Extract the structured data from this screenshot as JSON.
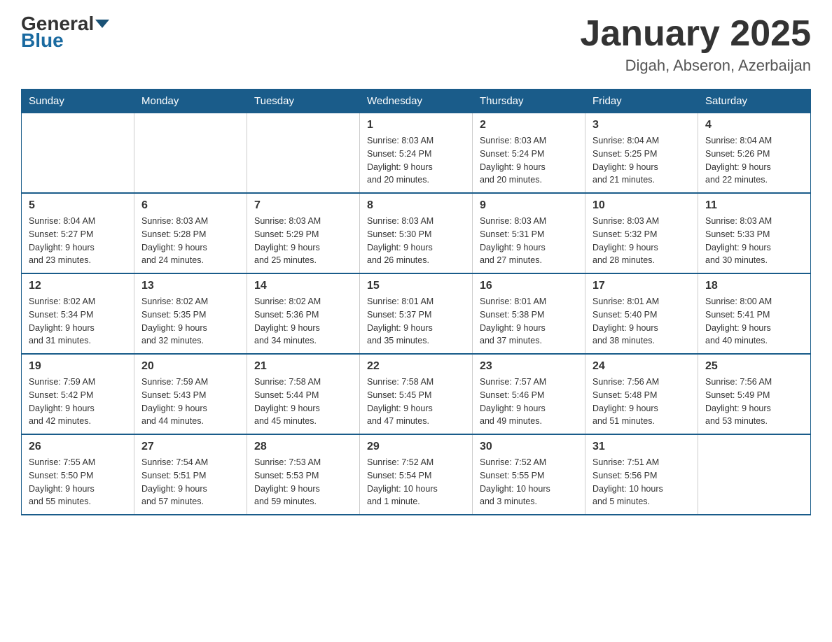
{
  "logo": {
    "general": "General",
    "blue": "Blue"
  },
  "header": {
    "month": "January 2025",
    "location": "Digah, Abseron, Azerbaijan"
  },
  "weekdays": [
    "Sunday",
    "Monday",
    "Tuesday",
    "Wednesday",
    "Thursday",
    "Friday",
    "Saturday"
  ],
  "weeks": [
    [
      {
        "day": "",
        "info": ""
      },
      {
        "day": "",
        "info": ""
      },
      {
        "day": "",
        "info": ""
      },
      {
        "day": "1",
        "info": "Sunrise: 8:03 AM\nSunset: 5:24 PM\nDaylight: 9 hours\nand 20 minutes."
      },
      {
        "day": "2",
        "info": "Sunrise: 8:03 AM\nSunset: 5:24 PM\nDaylight: 9 hours\nand 20 minutes."
      },
      {
        "day": "3",
        "info": "Sunrise: 8:04 AM\nSunset: 5:25 PM\nDaylight: 9 hours\nand 21 minutes."
      },
      {
        "day": "4",
        "info": "Sunrise: 8:04 AM\nSunset: 5:26 PM\nDaylight: 9 hours\nand 22 minutes."
      }
    ],
    [
      {
        "day": "5",
        "info": "Sunrise: 8:04 AM\nSunset: 5:27 PM\nDaylight: 9 hours\nand 23 minutes."
      },
      {
        "day": "6",
        "info": "Sunrise: 8:03 AM\nSunset: 5:28 PM\nDaylight: 9 hours\nand 24 minutes."
      },
      {
        "day": "7",
        "info": "Sunrise: 8:03 AM\nSunset: 5:29 PM\nDaylight: 9 hours\nand 25 minutes."
      },
      {
        "day": "8",
        "info": "Sunrise: 8:03 AM\nSunset: 5:30 PM\nDaylight: 9 hours\nand 26 minutes."
      },
      {
        "day": "9",
        "info": "Sunrise: 8:03 AM\nSunset: 5:31 PM\nDaylight: 9 hours\nand 27 minutes."
      },
      {
        "day": "10",
        "info": "Sunrise: 8:03 AM\nSunset: 5:32 PM\nDaylight: 9 hours\nand 28 minutes."
      },
      {
        "day": "11",
        "info": "Sunrise: 8:03 AM\nSunset: 5:33 PM\nDaylight: 9 hours\nand 30 minutes."
      }
    ],
    [
      {
        "day": "12",
        "info": "Sunrise: 8:02 AM\nSunset: 5:34 PM\nDaylight: 9 hours\nand 31 minutes."
      },
      {
        "day": "13",
        "info": "Sunrise: 8:02 AM\nSunset: 5:35 PM\nDaylight: 9 hours\nand 32 minutes."
      },
      {
        "day": "14",
        "info": "Sunrise: 8:02 AM\nSunset: 5:36 PM\nDaylight: 9 hours\nand 34 minutes."
      },
      {
        "day": "15",
        "info": "Sunrise: 8:01 AM\nSunset: 5:37 PM\nDaylight: 9 hours\nand 35 minutes."
      },
      {
        "day": "16",
        "info": "Sunrise: 8:01 AM\nSunset: 5:38 PM\nDaylight: 9 hours\nand 37 minutes."
      },
      {
        "day": "17",
        "info": "Sunrise: 8:01 AM\nSunset: 5:40 PM\nDaylight: 9 hours\nand 38 minutes."
      },
      {
        "day": "18",
        "info": "Sunrise: 8:00 AM\nSunset: 5:41 PM\nDaylight: 9 hours\nand 40 minutes."
      }
    ],
    [
      {
        "day": "19",
        "info": "Sunrise: 7:59 AM\nSunset: 5:42 PM\nDaylight: 9 hours\nand 42 minutes."
      },
      {
        "day": "20",
        "info": "Sunrise: 7:59 AM\nSunset: 5:43 PM\nDaylight: 9 hours\nand 44 minutes."
      },
      {
        "day": "21",
        "info": "Sunrise: 7:58 AM\nSunset: 5:44 PM\nDaylight: 9 hours\nand 45 minutes."
      },
      {
        "day": "22",
        "info": "Sunrise: 7:58 AM\nSunset: 5:45 PM\nDaylight: 9 hours\nand 47 minutes."
      },
      {
        "day": "23",
        "info": "Sunrise: 7:57 AM\nSunset: 5:46 PM\nDaylight: 9 hours\nand 49 minutes."
      },
      {
        "day": "24",
        "info": "Sunrise: 7:56 AM\nSunset: 5:48 PM\nDaylight: 9 hours\nand 51 minutes."
      },
      {
        "day": "25",
        "info": "Sunrise: 7:56 AM\nSunset: 5:49 PM\nDaylight: 9 hours\nand 53 minutes."
      }
    ],
    [
      {
        "day": "26",
        "info": "Sunrise: 7:55 AM\nSunset: 5:50 PM\nDaylight: 9 hours\nand 55 minutes."
      },
      {
        "day": "27",
        "info": "Sunrise: 7:54 AM\nSunset: 5:51 PM\nDaylight: 9 hours\nand 57 minutes."
      },
      {
        "day": "28",
        "info": "Sunrise: 7:53 AM\nSunset: 5:53 PM\nDaylight: 9 hours\nand 59 minutes."
      },
      {
        "day": "29",
        "info": "Sunrise: 7:52 AM\nSunset: 5:54 PM\nDaylight: 10 hours\nand 1 minute."
      },
      {
        "day": "30",
        "info": "Sunrise: 7:52 AM\nSunset: 5:55 PM\nDaylight: 10 hours\nand 3 minutes."
      },
      {
        "day": "31",
        "info": "Sunrise: 7:51 AM\nSunset: 5:56 PM\nDaylight: 10 hours\nand 5 minutes."
      },
      {
        "day": "",
        "info": ""
      }
    ]
  ]
}
